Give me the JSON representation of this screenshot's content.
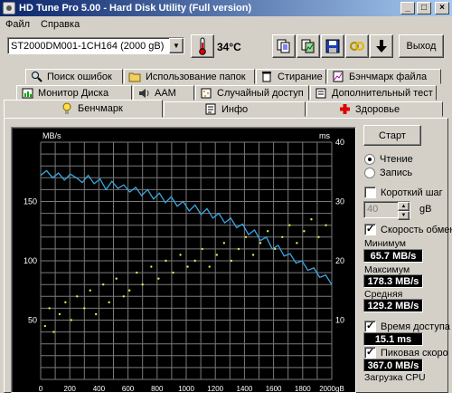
{
  "window": {
    "title": "HD Tune Pro 5.00 - Hard Disk Utility (Full  version)",
    "minimize": "_",
    "maximize": "□",
    "close": "×"
  },
  "menu": [
    {
      "label": "Файл"
    },
    {
      "label": "Справка"
    }
  ],
  "toolbar": {
    "drive": "ST2000DM001-1CH164 (2000 gB)",
    "temperature": "34°C",
    "exit_label": "Выход",
    "icons": [
      "copy-text-icon",
      "copy-screenshot-icon",
      "save-icon",
      "options-icon",
      "download-icon"
    ]
  },
  "tabs_row1": [
    {
      "label": "Поиск ошибок",
      "icon": "magnifier-icon"
    },
    {
      "label": "Использование папок",
      "icon": "folder-icon"
    },
    {
      "label": "Стирание",
      "icon": "trash-icon"
    },
    {
      "label": "Бэнчмарк файла",
      "icon": "file-benchmark-icon"
    }
  ],
  "tabs_row2": [
    {
      "label": "Монитор Диска",
      "icon": "monitor-icon"
    },
    {
      "label": "AAM",
      "icon": "speaker-icon"
    },
    {
      "label": "Случайный доступ",
      "icon": "random-icon"
    },
    {
      "label": "Дополнительный  тест",
      "icon": "extra-test-icon"
    }
  ],
  "tabs_row3": [
    {
      "label": "Бенчмарк",
      "icon": "bulb-icon",
      "active": true
    },
    {
      "label": "Инфо",
      "icon": "info-icon"
    },
    {
      "label": "Здоровье",
      "icon": "health-cross-icon"
    }
  ],
  "controls": {
    "start_label": "Старт",
    "read_label": "Чтение",
    "write_label": "Запись",
    "short_stroke_label": "Короткий шаг",
    "short_stroke_value": "40",
    "short_stroke_unit": "gB",
    "transfer_rate_label": "Скорость обмен",
    "min_label": "Минимум",
    "min_value": "65.7 MB/s",
    "max_label": "Максимум",
    "max_value": "178.3 MB/s",
    "avg_label": "Средняя",
    "avg_value": "129.2 MB/s",
    "access_time_label": "Время доступа",
    "access_time_value": "15.1 ms",
    "burst_label": "Пиковая скоро",
    "burst_value": "367.0 MB/s",
    "cpu_label": "Загрузка CPU"
  },
  "colors": {
    "transfer_line": "#3aa6e0",
    "access_points": "#e8e84a",
    "chart_bg": "#000000",
    "grid": "#7a7a7a"
  },
  "chart_data": {
    "type": "line",
    "y_label_left": "MB/s",
    "y_label_right": "ms",
    "ylim": [
      0,
      200
    ],
    "ylim_right": [
      0,
      40
    ],
    "y_ticks_left": [
      "150",
      "100",
      "50"
    ],
    "y_ticks_right": [
      "40",
      "30",
      "20",
      "10"
    ],
    "x_ticks": [
      "0",
      "200",
      "400",
      "600",
      "800",
      "1000",
      "1200",
      "1400",
      "1600",
      "1800",
      "2000gB"
    ],
    "xlim": [
      0,
      2000
    ],
    "series": [
      {
        "values": [
          172,
          176,
          170,
          174,
          168,
          173,
          170,
          166,
          172,
          165,
          169,
          160,
          167,
          161,
          164,
          158,
          162,
          155,
          160,
          152,
          157,
          149,
          154,
          146,
          150,
          142,
          147,
          139,
          144,
          136,
          140,
          132,
          136,
          128,
          131,
          122,
          126,
          117,
          120,
          110,
          113,
          104,
          106,
          98,
          100,
          92,
          94,
          86,
          88,
          80
        ],
        "x_start": 0,
        "x_step": 40.8
      },
      {
        "description_only_of_marks": "",
        "x": [
          30,
          60,
          90,
          130,
          170,
          210,
          250,
          300,
          340,
          380,
          430,
          470,
          520,
          570,
          610,
          660,
          700,
          760,
          810,
          860,
          910,
          960,
          1010,
          1060,
          1110,
          1160,
          1210,
          1260,
          1310,
          1360,
          1410,
          1460,
          1510,
          1560,
          1610,
          1660,
          1710,
          1760,
          1810,
          1860,
          1910,
          1960
        ],
        "y": [
          9,
          12,
          8,
          11,
          13,
          10,
          14,
          12,
          15,
          11,
          16,
          13,
          17,
          14,
          15,
          18,
          16,
          19,
          17,
          20,
          18,
          21,
          19,
          20,
          22,
          19,
          21,
          23,
          20,
          22,
          24,
          21,
          23,
          25,
          22,
          24,
          26,
          23,
          25,
          27,
          24,
          26
        ]
      }
    ],
    "grid": true
  }
}
